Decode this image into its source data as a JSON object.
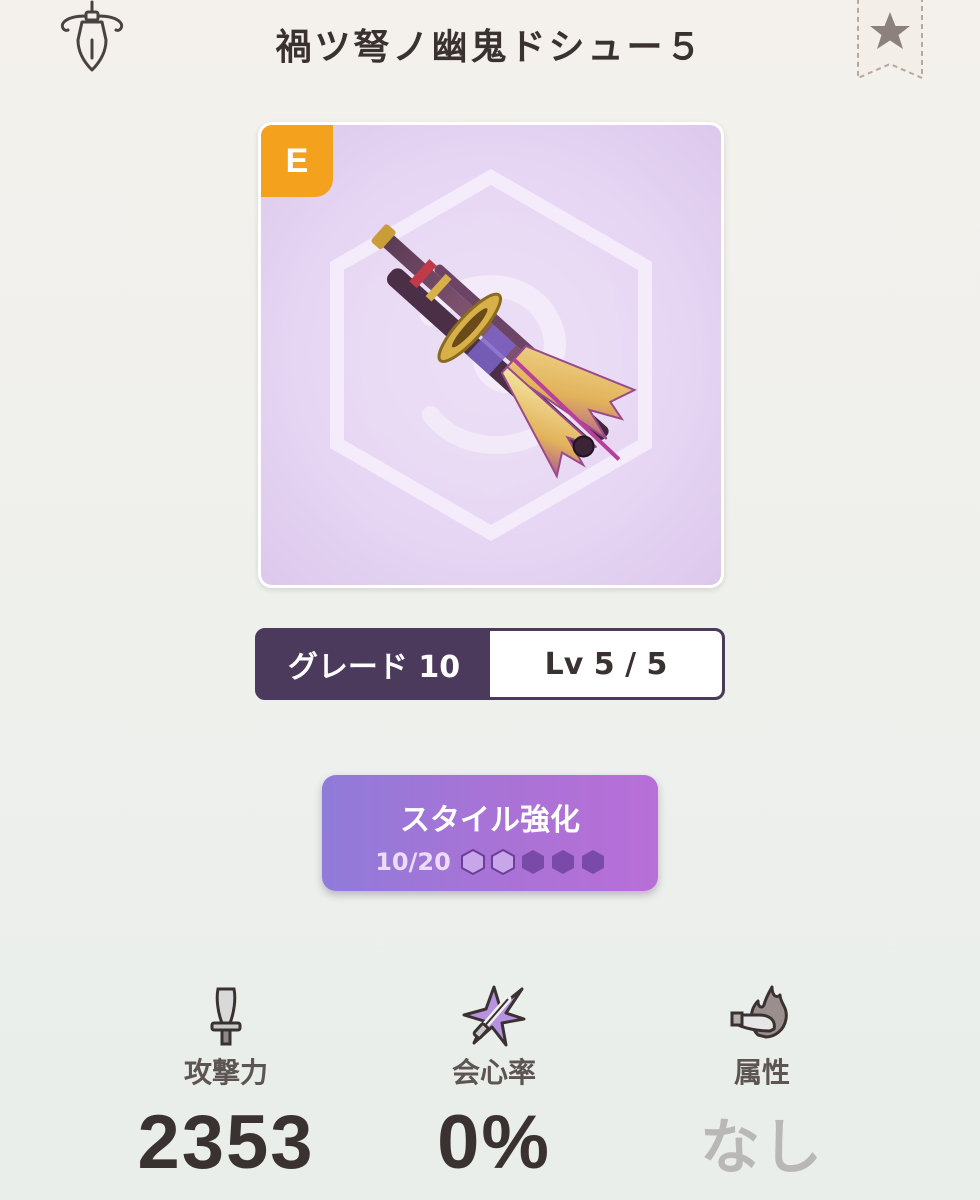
{
  "header": {
    "title": "禍ツ弩ノ幽鬼ドシュー５",
    "left_icon": "equipment-hanger-icon",
    "right_icon": "bookmark-star-icon"
  },
  "weapon_card": {
    "rank_letter": "E",
    "image": "bow-weapon-illustration"
  },
  "grade": {
    "label": "グレード 10",
    "level": "Lv 5 / 5"
  },
  "style_upgrade": {
    "label": "スタイル強化",
    "progress_text": "10/20",
    "pips_total": 5,
    "pips_filled": 2
  },
  "stats": [
    {
      "label": "攻撃力",
      "value": "2353",
      "icon": "sword-icon"
    },
    {
      "label": "会心率",
      "value": "0%",
      "icon": "critical-sword-icon"
    },
    {
      "label": "属性",
      "value": "なし",
      "icon": "element-fire-sword-icon"
    }
  ],
  "colors": {
    "rank_badge": "#f4a21e",
    "grade_bar": "#4b3a5c",
    "style_button_start": "#8f7bd9",
    "style_button_end": "#b86fd8",
    "text_dark": "#3a3230"
  }
}
